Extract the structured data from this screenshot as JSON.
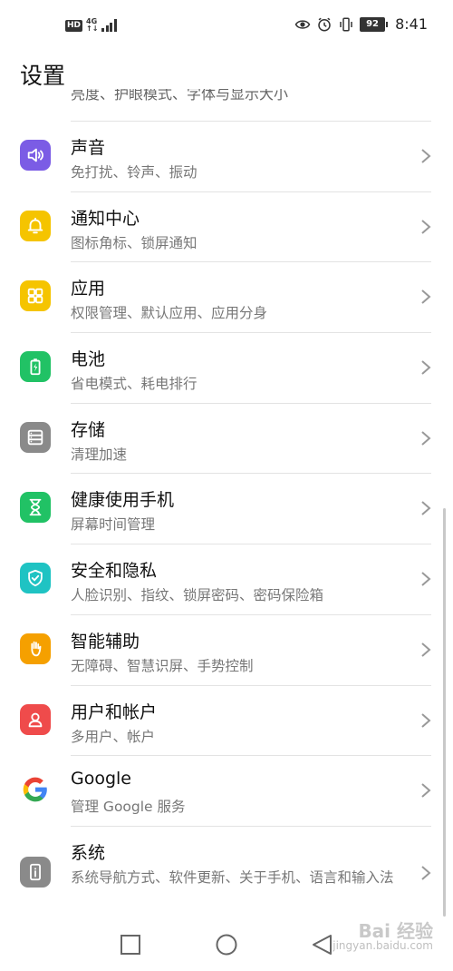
{
  "status_bar": {
    "hd": "HD",
    "network": "4G",
    "network_sub": "↑↓",
    "battery_level": "92",
    "time": "8:41"
  },
  "page": {
    "title": "设置",
    "clipped_row_text": "亮度、护眼模式、字体与显示大小"
  },
  "items": [
    {
      "title": "声音",
      "subtitle": "免打扰、铃声、振动",
      "icon": "speaker-icon",
      "color": "#7b5ce5"
    },
    {
      "title": "通知中心",
      "subtitle": "图标角标、锁屏通知",
      "icon": "bell-icon",
      "color": "#f5c400"
    },
    {
      "title": "应用",
      "subtitle": "权限管理、默认应用、应用分身",
      "icon": "apps-grid-icon",
      "color": "#f5c400"
    },
    {
      "title": "电池",
      "subtitle": "省电模式、耗电排行",
      "icon": "battery-icon",
      "color": "#21c265"
    },
    {
      "title": "存储",
      "subtitle": "清理加速",
      "icon": "storage-icon",
      "color": "#8a8a8a"
    },
    {
      "title": "健康使用手机",
      "subtitle": "屏幕时间管理",
      "icon": "hourglass-icon",
      "color": "#21c265"
    },
    {
      "title": "安全和隐私",
      "subtitle": "人脸识别、指纹、锁屏密码、密码保险箱",
      "icon": "shield-icon",
      "color": "#1fc3c3"
    },
    {
      "title": "智能辅助",
      "subtitle": "无障碍、智慧识屏、手势控制",
      "icon": "hand-icon",
      "color": "#f5a000"
    },
    {
      "title": "用户和帐户",
      "subtitle": "多用户、帐户",
      "icon": "user-icon",
      "color": "#ef4b4b"
    },
    {
      "title": "Google",
      "subtitle": "管理 Google 服务",
      "icon": "google-icon",
      "color": "#ffffff"
    },
    {
      "title": "系统",
      "subtitle": "系统导航方式、软件更新、关于手机、语言和输入法",
      "icon": "phone-info-icon",
      "color": "#8a8a8a"
    }
  ],
  "watermark": {
    "brand": "Bai 经验",
    "url": "jingyan.baidu.com"
  }
}
